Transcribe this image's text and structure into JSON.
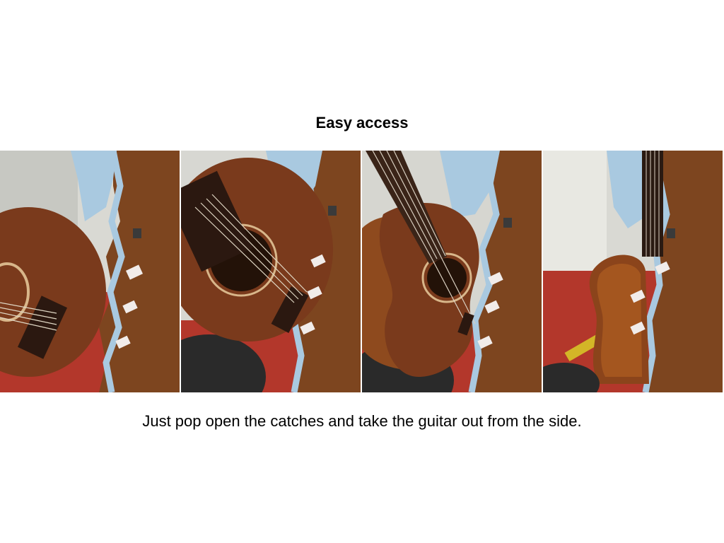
{
  "slide": {
    "title": "Easy access",
    "caption": "Just pop open the catches and take the guitar out from the side."
  },
  "photos": [
    {
      "subject": "guitar-in-case-closed-view"
    },
    {
      "subject": "guitar-soundhole-view"
    },
    {
      "subject": "guitar-lifting-out-view"
    },
    {
      "subject": "guitar-side-profile-view"
    }
  ],
  "colors": {
    "background": "#ffffff",
    "wood": "#8a4a22",
    "case_shell": "#7a4320",
    "foam": "#a9c9e0",
    "floor": "#b5352a",
    "wall": "#d8d8d2"
  }
}
